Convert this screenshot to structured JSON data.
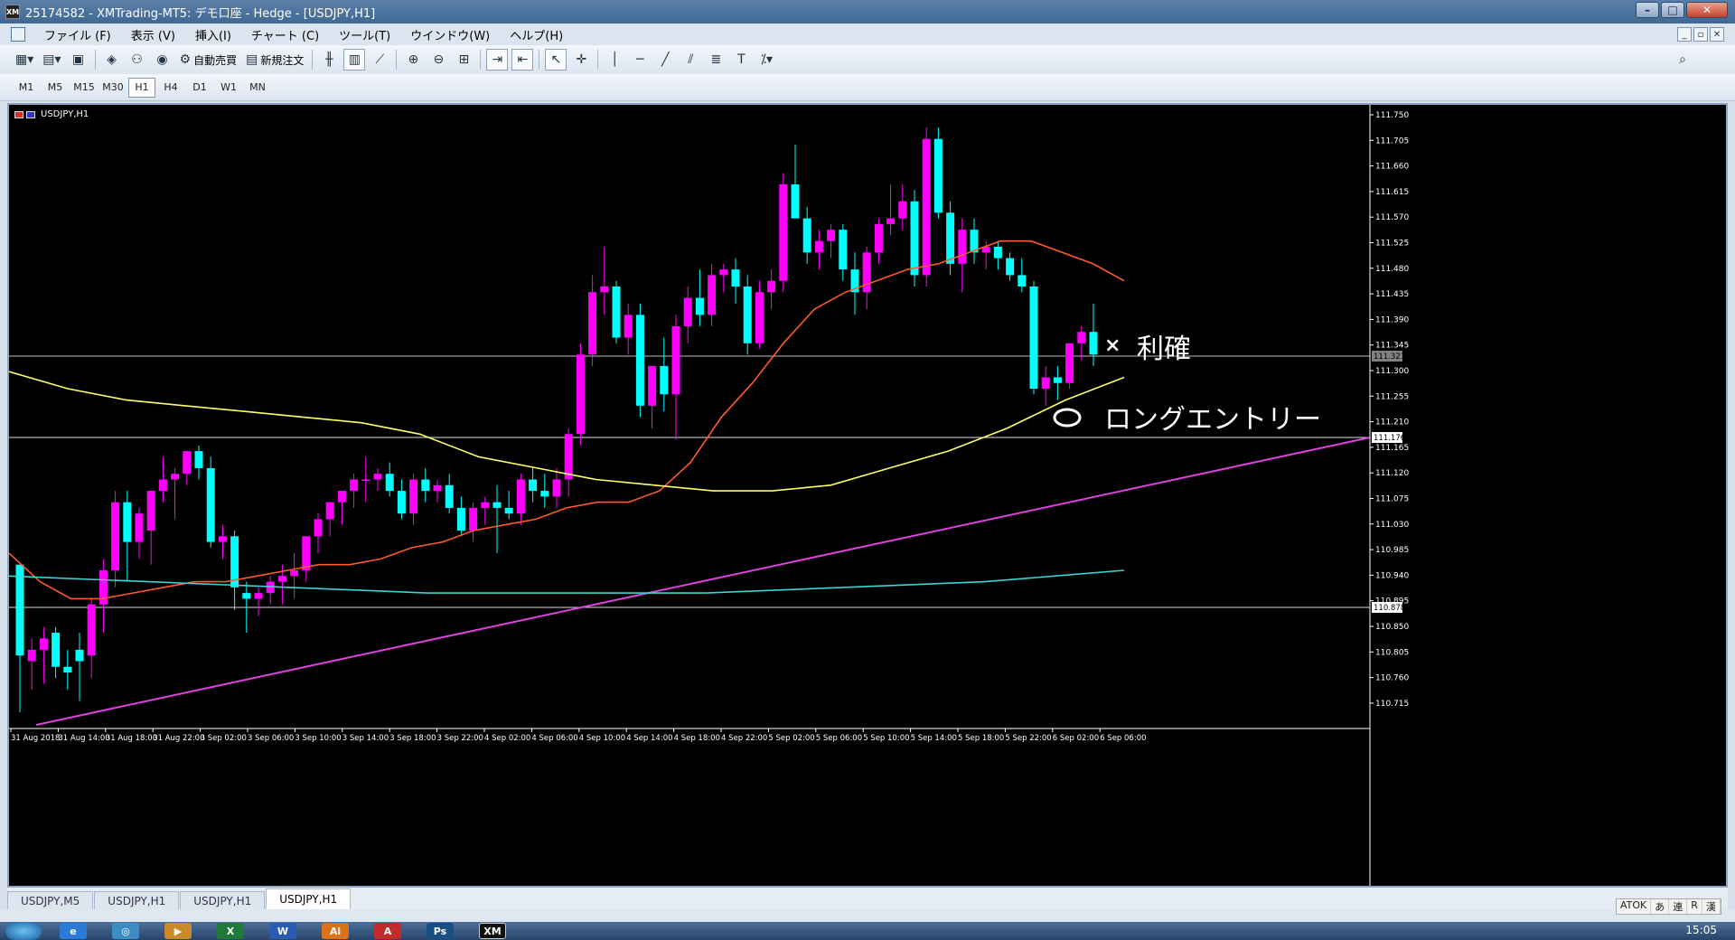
{
  "window": {
    "title": "25174582 - XMTrading-MT5: デモ口座 - Hedge - [USDJPY,H1]",
    "app_icon_text": "XM"
  },
  "menu": [
    "ファイル (F)",
    "表示 (V)",
    "挿入(I)",
    "チャート (C)",
    "ツール(T)",
    "ウインドウ(W)",
    "ヘルプ(H)"
  ],
  "toolbar": {
    "auto_trade_label": "自動売買",
    "new_order_label": "新規注文"
  },
  "timeframes": [
    "M1",
    "M5",
    "M15",
    "M30",
    "H1",
    "H4",
    "D1",
    "W1",
    "MN"
  ],
  "active_timeframe": "H1",
  "chart": {
    "symbol_label": "USDJPY,H1",
    "price_labels": [
      "111.750",
      "111.705",
      "111.660",
      "111.615",
      "111.570",
      "111.525",
      "111.480",
      "111.435",
      "111.390",
      "111.345",
      "111.300",
      "111.255",
      "111.210",
      "111.165",
      "111.120",
      "111.075",
      "111.030",
      "110.985",
      "110.940",
      "110.895",
      "110.850",
      "110.805",
      "110.760",
      "110.715"
    ],
    "bid_marker": "111.321",
    "line_markers": [
      "111.176",
      "110.878"
    ],
    "time_labels": [
      "31 Aug 2018",
      "31 Aug 14:00",
      "31 Aug 18:00",
      "31 Aug 22:00",
      "3 Sep 02:00",
      "3 Sep 06:00",
      "3 Sep 10:00",
      "3 Sep 14:00",
      "3 Sep 18:00",
      "3 Sep 22:00",
      "4 Sep 02:00",
      "4 Sep 06:00",
      "4 Sep 10:00",
      "4 Sep 14:00",
      "4 Sep 18:00",
      "4 Sep 22:00",
      "5 Sep 02:00",
      "5 Sep 06:00",
      "5 Sep 10:00",
      "5 Sep 14:00",
      "5 Sep 18:00",
      "5 Sep 22:00",
      "6 Sep 02:00",
      "6 Sep 06:00"
    ],
    "annotations": {
      "take_profit": "利確",
      "long_entry": "ロングエントリー",
      "take_profit_mark": "×",
      "entry_mark": "○"
    },
    "colors": {
      "bull": "#ff00ff",
      "bear": "#00ffff",
      "ma_fast": "#ff5a2a",
      "ma_mid": "#ffff66",
      "ma_slow": "#3cd6d6",
      "trend": "#e040e0"
    }
  },
  "chart_data": {
    "type": "candlestick",
    "title": "USDJPY,H1",
    "ylim": [
      110.7,
      111.77
    ],
    "series": [
      {
        "name": "candles",
        "values": [
          [
            110.96,
            110.96,
            110.7,
            110.8
          ],
          [
            110.79,
            110.83,
            110.74,
            110.81
          ],
          [
            110.81,
            110.85,
            110.75,
            110.83
          ],
          [
            110.84,
            110.85,
            110.76,
            110.78
          ],
          [
            110.78,
            110.81,
            110.74,
            110.77
          ],
          [
            110.81,
            110.84,
            110.72,
            110.79
          ],
          [
            110.8,
            110.9,
            110.76,
            110.89
          ],
          [
            110.89,
            110.97,
            110.84,
            110.95
          ],
          [
            110.95,
            111.09,
            110.92,
            111.07
          ],
          [
            111.07,
            111.09,
            110.93,
            111.0
          ],
          [
            111.0,
            111.06,
            110.97,
            111.05
          ],
          [
            111.02,
            111.08,
            110.96,
            111.09
          ],
          [
            111.09,
            111.15,
            111.07,
            111.11
          ],
          [
            111.11,
            111.13,
            111.04,
            111.12
          ],
          [
            111.12,
            111.16,
            111.1,
            111.16
          ],
          [
            111.16,
            111.17,
            111.11,
            111.13
          ],
          [
            111.13,
            111.15,
            110.99,
            111.0
          ],
          [
            111.0,
            111.03,
            110.97,
            111.01
          ],
          [
            111.01,
            111.02,
            110.88,
            110.92
          ],
          [
            110.91,
            110.93,
            110.84,
            110.9
          ],
          [
            110.9,
            110.92,
            110.87,
            110.91
          ],
          [
            110.91,
            110.94,
            110.89,
            110.93
          ],
          [
            110.93,
            110.96,
            110.89,
            110.94
          ],
          [
            110.94,
            110.98,
            110.9,
            110.95
          ],
          [
            110.95,
            110.99,
            110.93,
            111.01
          ],
          [
            111.01,
            111.05,
            110.98,
            111.04
          ],
          [
            111.04,
            111.07,
            111.01,
            111.07
          ],
          [
            111.07,
            111.09,
            111.03,
            111.09
          ],
          [
            111.09,
            111.12,
            111.06,
            111.11
          ],
          [
            111.11,
            111.15,
            111.07,
            111.11
          ],
          [
            111.11,
            111.13,
            111.09,
            111.12
          ],
          [
            111.12,
            111.14,
            111.08,
            111.09
          ],
          [
            111.09,
            111.11,
            111.04,
            111.05
          ],
          [
            111.05,
            111.12,
            111.03,
            111.11
          ],
          [
            111.11,
            111.13,
            111.07,
            111.09
          ],
          [
            111.09,
            111.11,
            111.07,
            111.1
          ],
          [
            111.1,
            111.12,
            111.05,
            111.06
          ],
          [
            111.06,
            111.08,
            111.01,
            111.02
          ],
          [
            111.02,
            111.07,
            111.0,
            111.06
          ],
          [
            111.06,
            111.08,
            111.03,
            111.07
          ],
          [
            111.07,
            111.1,
            110.98,
            111.06
          ],
          [
            111.06,
            111.09,
            111.04,
            111.05
          ],
          [
            111.05,
            111.12,
            111.03,
            111.11
          ],
          [
            111.11,
            111.13,
            111.07,
            111.09
          ],
          [
            111.09,
            111.12,
            111.06,
            111.08
          ],
          [
            111.08,
            111.13,
            111.06,
            111.11
          ],
          [
            111.11,
            111.2,
            111.08,
            111.19
          ],
          [
            111.19,
            111.35,
            111.17,
            111.33
          ],
          [
            111.33,
            111.47,
            111.31,
            111.44
          ],
          [
            111.44,
            111.52,
            111.4,
            111.45
          ],
          [
            111.45,
            111.46,
            111.35,
            111.36
          ],
          [
            111.36,
            111.42,
            111.33,
            111.4
          ],
          [
            111.4,
            111.42,
            111.22,
            111.24
          ],
          [
            111.24,
            111.31,
            111.2,
            111.31
          ],
          [
            111.31,
            111.36,
            111.23,
            111.26
          ],
          [
            111.26,
            111.4,
            111.18,
            111.38
          ],
          [
            111.38,
            111.45,
            111.35,
            111.43
          ],
          [
            111.43,
            111.48,
            111.38,
            111.4
          ],
          [
            111.4,
            111.49,
            111.38,
            111.47
          ],
          [
            111.47,
            111.49,
            111.44,
            111.48
          ],
          [
            111.48,
            111.5,
            111.42,
            111.45
          ],
          [
            111.45,
            111.47,
            111.33,
            111.35
          ],
          [
            111.35,
            111.46,
            111.34,
            111.44
          ],
          [
            111.44,
            111.48,
            111.41,
            111.46
          ],
          [
            111.46,
            111.65,
            111.44,
            111.63
          ],
          [
            111.63,
            111.7,
            111.57,
            111.57
          ],
          [
            111.57,
            111.59,
            111.49,
            111.51
          ],
          [
            111.51,
            111.55,
            111.48,
            111.53
          ],
          [
            111.53,
            111.56,
            111.5,
            111.55
          ],
          [
            111.55,
            111.56,
            111.46,
            111.48
          ],
          [
            111.48,
            111.51,
            111.4,
            111.44
          ],
          [
            111.44,
            111.52,
            111.41,
            111.51
          ],
          [
            111.51,
            111.57,
            111.49,
            111.56
          ],
          [
            111.56,
            111.63,
            111.54,
            111.57
          ],
          [
            111.57,
            111.63,
            111.55,
            111.6
          ],
          [
            111.6,
            111.62,
            111.45,
            111.47
          ],
          [
            111.47,
            111.73,
            111.45,
            111.71
          ],
          [
            111.71,
            111.73,
            111.57,
            111.58
          ],
          [
            111.58,
            111.6,
            111.47,
            111.49
          ],
          [
            111.49,
            111.57,
            111.44,
            111.55
          ],
          [
            111.55,
            111.57,
            111.49,
            111.51
          ],
          [
            111.51,
            111.53,
            111.48,
            111.52
          ],
          [
            111.52,
            111.53,
            111.48,
            111.5
          ],
          [
            111.5,
            111.51,
            111.46,
            111.47
          ],
          [
            111.47,
            111.5,
            111.44,
            111.45
          ],
          [
            111.45,
            111.46,
            111.26,
            111.27
          ],
          [
            111.27,
            111.31,
            111.24,
            111.29
          ],
          [
            111.29,
            111.31,
            111.25,
            111.28
          ],
          [
            111.28,
            111.33,
            111.27,
            111.35
          ],
          [
            111.35,
            111.38,
            111.32,
            111.37
          ],
          [
            111.37,
            111.42,
            111.31,
            111.33
          ]
        ]
      },
      {
        "name": "MA fast (orange)",
        "values": [
          110.98,
          110.93,
          110.9,
          110.9,
          110.91,
          110.92,
          110.93,
          110.93,
          110.94,
          110.95,
          110.96,
          110.96,
          110.97,
          110.99,
          111.0,
          111.02,
          111.03,
          111.04,
          111.06,
          111.07,
          111.07,
          111.09,
          111.14,
          111.22,
          111.28,
          111.35,
          111.41,
          111.44,
          111.46,
          111.48,
          111.49,
          111.51,
          111.53,
          111.53,
          111.51,
          111.49,
          111.46
        ]
      },
      {
        "name": "MA mid (yellow)",
        "values": [
          111.3,
          111.27,
          111.25,
          111.24,
          111.23,
          111.22,
          111.21,
          111.19,
          111.15,
          111.13,
          111.11,
          111.1,
          111.09,
          111.09,
          111.1,
          111.13,
          111.16,
          111.2,
          111.25,
          111.29
        ]
      },
      {
        "name": "MA slow (cyan)",
        "values": [
          110.94,
          110.93,
          110.92,
          110.91,
          110.91,
          110.91,
          110.92,
          110.93,
          110.95
        ]
      }
    ]
  }
}
